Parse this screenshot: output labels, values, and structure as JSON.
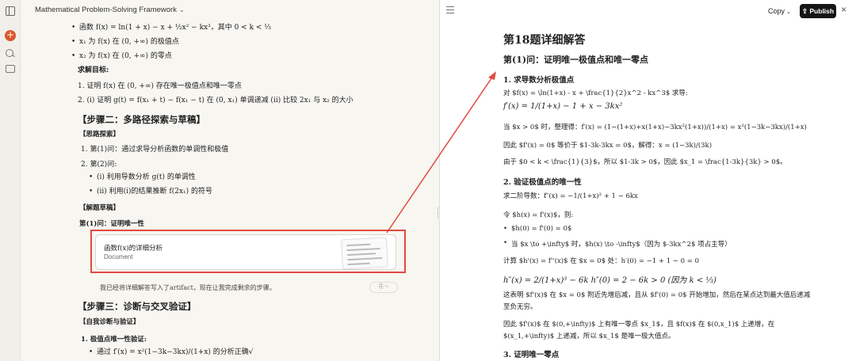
{
  "chat": {
    "title": "Mathematical Problem-Solving Framework",
    "lines": {
      "fx": "函数 f(x) = ln(1 + x) − x + ½x² − kx³，其中 0 < k < ⅓",
      "x1": "x₁ 为 f(x) 在 (0, +∞) 的极值点",
      "x2": "x₂ 为 f(x) 在 (0, +∞) 的零点",
      "goal": "求解目标:",
      "goal1": "1. 证明 f(x) 在 (0, +∞) 存在唯一极值点和唯一零点",
      "goal2": "2. (i) 证明 g(t) = f(x₁ + t) − f(x₁ − t) 在 (0, x₁) 单调递减 (ii) 比较 2x₁ 与 x₂ 的大小",
      "step2": "【步骤二：多路径探索与草稿】",
      "thinking": "【思路探索】",
      "p1": "1. 第(1)问：通过求导分析函数的单调性和极值",
      "p2": "2. 第(2)问:",
      "p2a": "(i) 利用导数分析 g(t) 的单调性",
      "p2b": "(ii) 利用(i)的结果推断 f(2x₁) 的符号",
      "draft": "【解题草稿】",
      "q1": "第(1)问：证明唯一性",
      "note": "我已经将详细解答写入了artifact，现在让我完成剩余的步骤。",
      "step3": "【步骤三：诊断与交叉验证】",
      "selfcheck": "【自我诊断与验证】",
      "c1": "1. 极值点唯一性验证:",
      "c1a": "通过 f′(x) = x²(1−3k−3kx)/(1+x) 的分析正确√"
    },
    "artifact": {
      "title": "函数f(x)的详细分析",
      "type": "Document"
    },
    "copy_chip": "⎘ ∿"
  },
  "doc": {
    "toolbar": {
      "copy": "Copy",
      "publish": "Publish"
    },
    "title": "第18题详细解答",
    "subtitle": "第(1)问：证明唯一极值点和唯一零点",
    "s1": "1. 求导数分析极值点",
    "s1_l1": "对 $f(x) = \\ln(1+x) - x + \\frac{1}{2}x^2 - kx^3$ 求导:",
    "s1_m1": "f′(x) = 1/(1+x) − 1 + x − 3kx²",
    "s1_l2": "当 $x > 0$ 时，整理得：f′(x) = (1−(1+x)+x(1+x)−3kx²(1+x))/(1+x) = x²(1−3k−3kx)/(1+x)",
    "s1_l3": "因此 $f'(x) = 0$ 等价于 $1-3k-3kx = 0$，解得：x = (1−3k)/(3k)",
    "s1_l4": "由于 $0 < k < \\frac{1}{3}$，所以 $1-3k > 0$，因此 $x_1 = \\frac{1-3k}{3k} > 0$。",
    "s2": "2. 验证极值点的唯一性",
    "s2_l1": "求二阶导数：f″(x) = −1/(1+x)² + 1 − 6kx",
    "s2_l2": "令 $h(x) = f'(x)$，则:",
    "s2_b1": "$h(0) = f'(0) = 0$",
    "s2_b2": "当 $x \\to +\\infty$ 时，$h(x) \\to -\\infty$（因为 $-3kx^2$ 项占主导）",
    "s2_l3": "计算 $h'(x) = f''(x)$ 在 $x = 0$ 处：h′(0) = −1 + 1 − 0 = 0",
    "s2_m1": "h″(x) = 2/(1+x)³ − 6k h″(0) = 2 − 6k > 0   (因为 k < ⅓)",
    "s2_l4": "这表明 $f'(x)$ 在 $x = 0$ 附近先增后减，且从 $f'(0) = 0$ 开始增加，然后在某点达到最大值后递减",
    "s2_l5": "至负无穷。",
    "s2_l6": "因此 $f'(x)$ 在 $(0,+\\infty)$ 上有唯一零点 $x_1$，且 $f(x)$ 在 $(0,x_1)$ 上递增，在",
    "s2_l7": "$(x_1,+\\infty)$ 上递减，所以 $x_1$ 是唯一极大值点。",
    "s3": "3. 证明唯一零点"
  }
}
